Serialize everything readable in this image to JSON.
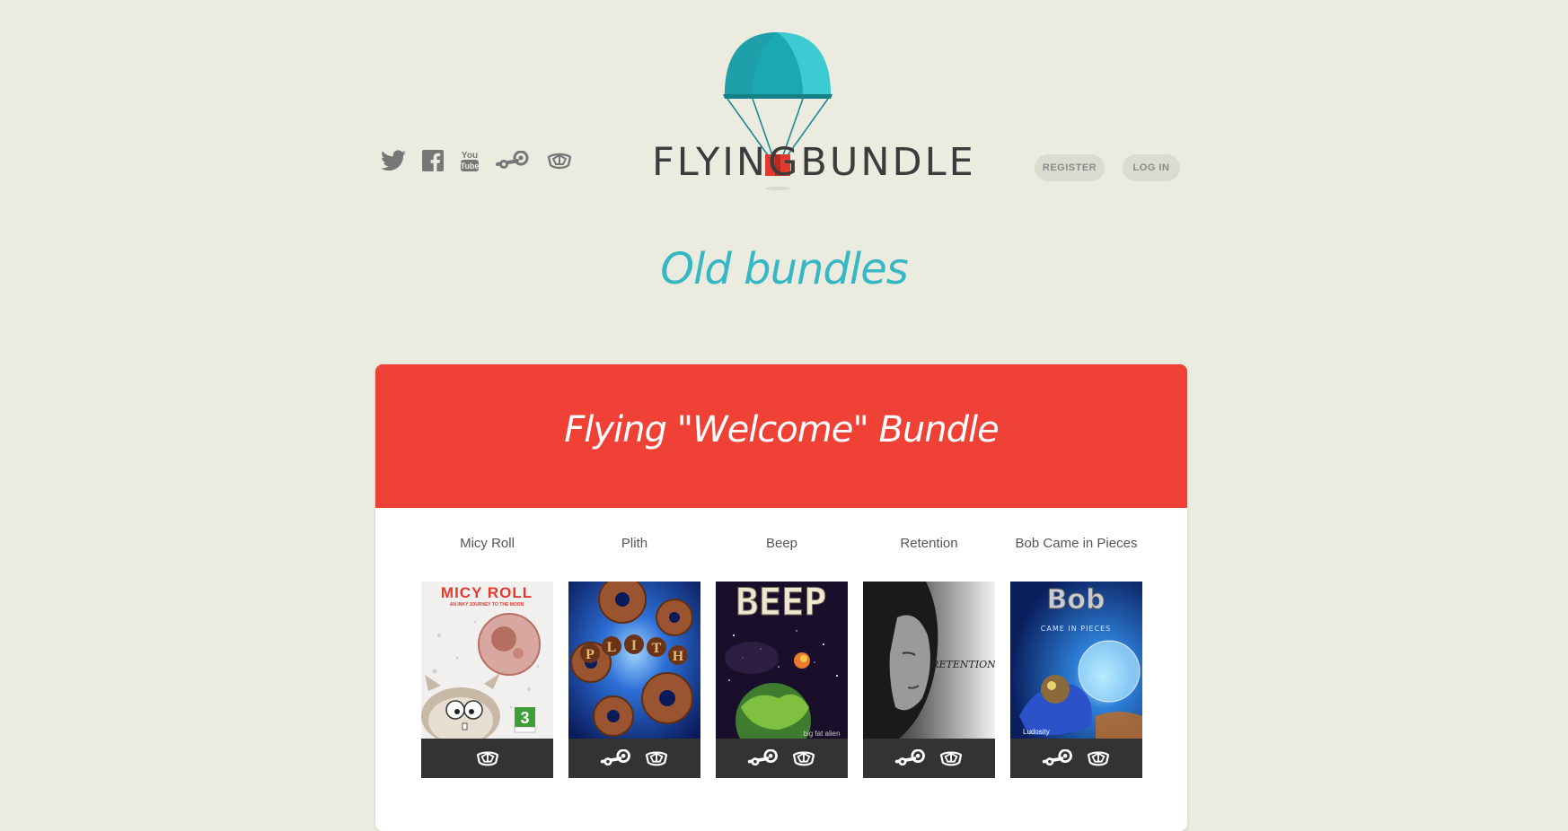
{
  "header": {
    "logo_word_left": "FLYING",
    "logo_word_right": "BUNDLE",
    "social_icons": [
      "twitter-icon",
      "facebook-icon",
      "youtube-icon",
      "steam-icon",
      "desura-icon"
    ],
    "register_label": "REGISTER",
    "login_label": "LOG IN"
  },
  "page_title": "Old bundles",
  "bundle": {
    "title": "Flying \"Welcome\" Bundle",
    "color": "#ef4136",
    "games": [
      {
        "name": "Micy Roll",
        "cover_title": "MICY ROLL",
        "cover_subtitle": "AN INKY JOURNEY TO THE MOON",
        "cover_badge": "3",
        "platforms": [
          "desura-icon"
        ]
      },
      {
        "name": "Plith",
        "cover_title": "PLITH",
        "platforms": [
          "steam-icon",
          "desura-icon"
        ]
      },
      {
        "name": "Beep",
        "cover_title": "BEEP",
        "cover_subtitle": "big fat alien",
        "platforms": [
          "steam-icon",
          "desura-icon"
        ]
      },
      {
        "name": "Retention",
        "cover_title": "RETENTION",
        "platforms": [
          "steam-icon",
          "desura-icon"
        ]
      },
      {
        "name": "Bob Came in Pieces",
        "cover_title": "Bob",
        "cover_subtitle": "CAME IN PIECES",
        "cover_publisher": "Ludosity",
        "platforms": [
          "steam-icon",
          "desura-icon"
        ]
      }
    ]
  },
  "colors": {
    "background": "#ecebe0",
    "accent": "#36b7c4",
    "parachute": "#1da6b1",
    "box": "#e23a2e",
    "platform_bar": "#333333"
  }
}
